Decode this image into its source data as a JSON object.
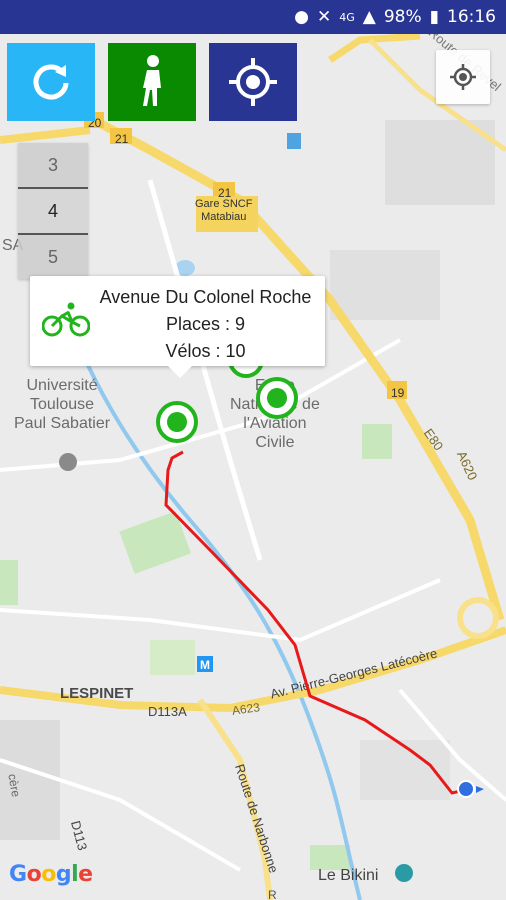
{
  "status": {
    "battery": "98%",
    "time": "16:16",
    "network": "4G"
  },
  "toolbar": {
    "refresh_icon": "refresh-icon",
    "walk_icon": "walking-person-icon",
    "target_icon": "crosshair-icon"
  },
  "colors": {
    "refresh_bg": "#29b6f6",
    "walk_bg": "#0a8a00",
    "target_bg": "#283593",
    "route": "#e8191b",
    "station": "#22b41c"
  },
  "floors": [
    "3",
    "4",
    "5"
  ],
  "active_floor": "4",
  "popup": {
    "name": "Avenue Du Colonel Roche",
    "places": "Places : 9",
    "velos": "Vélos : 10"
  },
  "map_labels": {
    "sa": "SA",
    "univ": "Université\nToulouse\nPaul Sabatier",
    "ecole": "Ecole\nNationale de\nl'Aviation\nCivile",
    "gare": "Gare SNCF\nMatabiau",
    "lespinet": "LESPINET",
    "d113a": "D113A",
    "d113": "D113",
    "av_latecoere": "Av. Pierre-Georges Latécoère",
    "route_narbonne": "Route de Narbonne",
    "route_revel": "Route de Revel",
    "bikini": "Le Bikini",
    "route_short": "R",
    "code21a": "21",
    "code21b": "21",
    "code20": "20",
    "code19": "19",
    "a620": "A620",
    "e80": "E80",
    "a623": "A623",
    "metro": "M",
    "cere": "cère"
  },
  "google": "Google"
}
